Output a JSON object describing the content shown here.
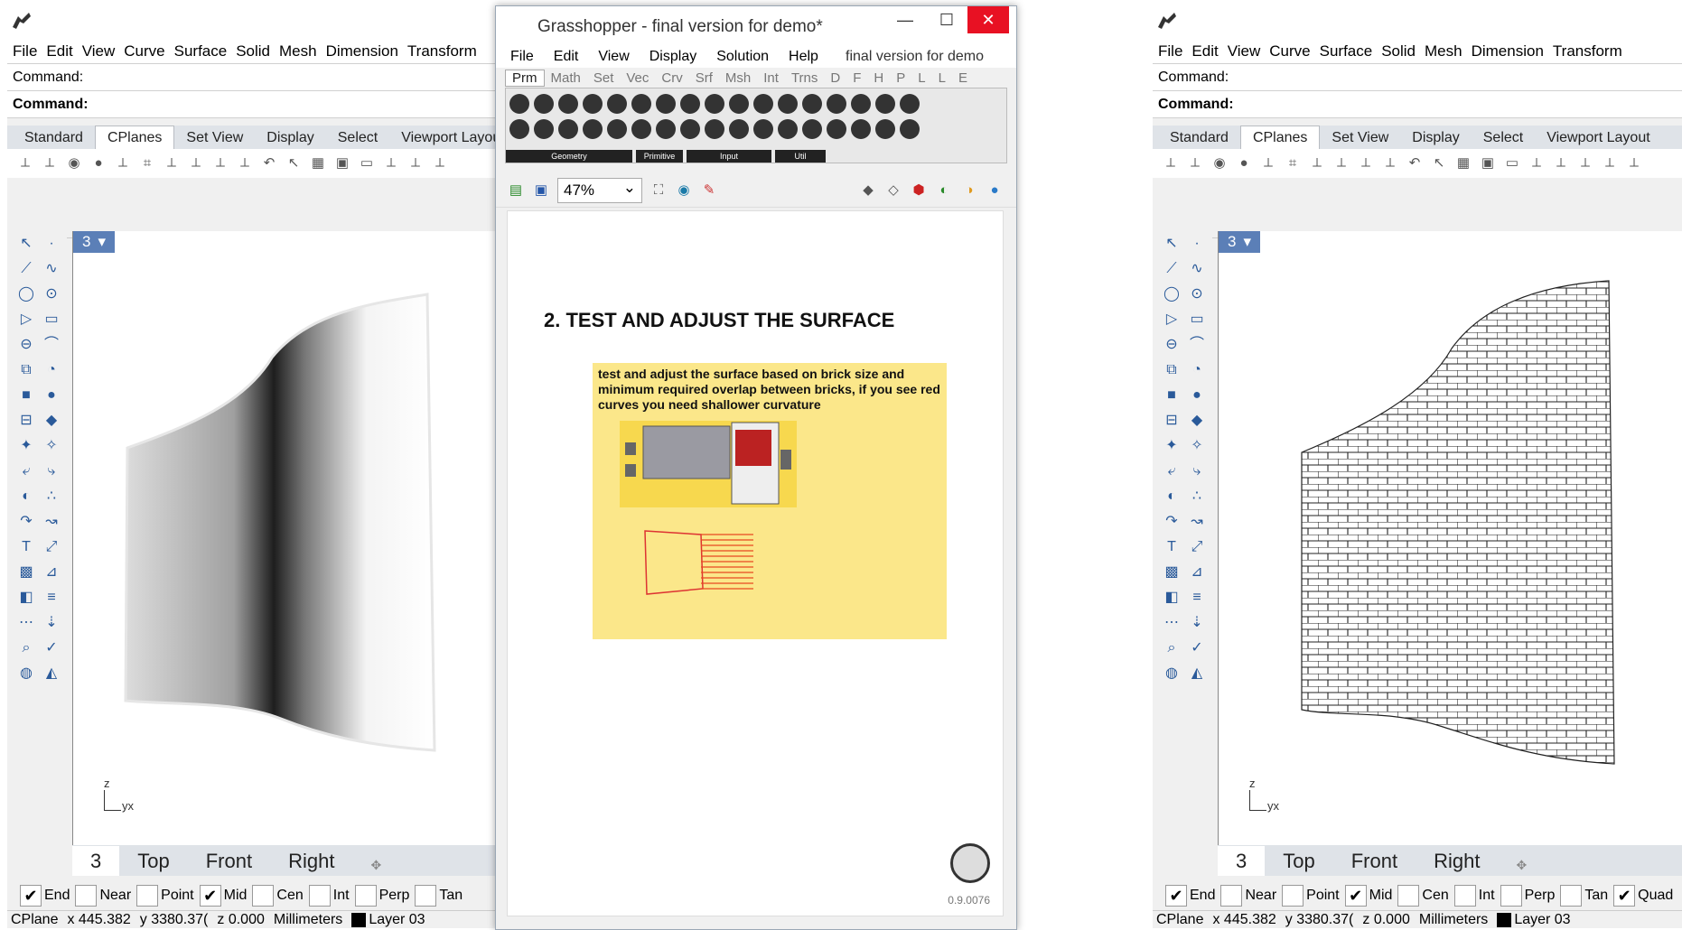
{
  "rhino": {
    "menus": [
      "File",
      "Edit",
      "View",
      "Curve",
      "Surface",
      "Solid",
      "Mesh",
      "Dimension",
      "Transform"
    ],
    "command_prompt": "Command:",
    "command_line": "Command:",
    "toolbar_tabs": [
      "Standard",
      "CPlanes",
      "Set View",
      "Display",
      "Select",
      "Viewport Layout"
    ],
    "active_toolbar_tab": "CPlanes",
    "viewport_number": "3",
    "axis_z": "z",
    "axis_yx": "yx",
    "viewport_tabs": [
      "3",
      "Top",
      "Front",
      "Right"
    ],
    "osnaps": [
      {
        "label": "End",
        "checked": true
      },
      {
        "label": "Near",
        "checked": false
      },
      {
        "label": "Point",
        "checked": false
      },
      {
        "label": "Mid",
        "checked": true
      },
      {
        "label": "Cen",
        "checked": false
      },
      {
        "label": "Int",
        "checked": false
      },
      {
        "label": "Perp",
        "checked": false
      },
      {
        "label": "Tan",
        "checked": false
      }
    ],
    "osnap_right_extra": "Quad",
    "status": {
      "cplane": "CPlane",
      "x": "x 445.382",
      "y": "y 3380.37(",
      "z": "z 0.000",
      "units": "Millimeters",
      "layer": "Layer 03"
    }
  },
  "grasshopper": {
    "title": "Grasshopper - final version for demo*",
    "menus": [
      "File",
      "Edit",
      "View",
      "Display",
      "Solution",
      "Help"
    ],
    "document_name": "final version for demo",
    "tabs": [
      "Prm",
      "Math",
      "Set",
      "Vec",
      "Crv",
      "Srf",
      "Msh",
      "Int",
      "Trns",
      "D",
      "F",
      "H",
      "P",
      "L",
      "L",
      "E"
    ],
    "active_tab": "Prm",
    "ribbon_categories": [
      "Geometry",
      "Primitive",
      "Input",
      "Util"
    ],
    "zoom": "47%",
    "heading": "2. TEST AND ADJUST THE SURFACE",
    "note": "test and adjust the surface based on brick size and minimum required overlap between bricks, if you see red curves you need shallower curvature",
    "version": "0.9.0076"
  }
}
